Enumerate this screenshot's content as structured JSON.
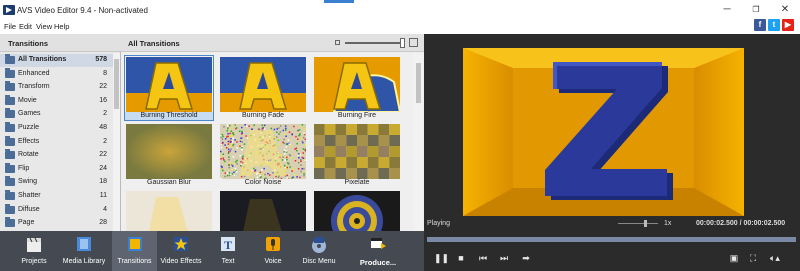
{
  "window": {
    "title": "AVS Video Editor 9.4 - Non-activated",
    "controls": [
      "─",
      "❐",
      "✕"
    ]
  },
  "menu": [
    "File",
    "Edit",
    "View",
    "Help"
  ],
  "social": [
    {
      "name": "facebook-icon",
      "glyph": "f",
      "color": "#3b5998"
    },
    {
      "name": "twitter-icon",
      "glyph": "t",
      "color": "#1da1f2"
    },
    {
      "name": "youtube-icon",
      "glyph": "▶",
      "color": "#e62117"
    }
  ],
  "left_panel": {
    "header": "Transitions",
    "categories": [
      {
        "name": "All Transitions",
        "count": "578",
        "selected": true
      },
      {
        "name": "Enhanced",
        "count": "8"
      },
      {
        "name": "Transform",
        "count": "22"
      },
      {
        "name": "Movie",
        "count": "16"
      },
      {
        "name": "Games",
        "count": "2"
      },
      {
        "name": "Puzzle",
        "count": "48"
      },
      {
        "name": "Effects",
        "count": "2"
      },
      {
        "name": "Rotate",
        "count": "22"
      },
      {
        "name": "Flip",
        "count": "24"
      },
      {
        "name": "Swing",
        "count": "18"
      },
      {
        "name": "Shatter",
        "count": "11"
      },
      {
        "name": "Diffuse",
        "count": "4"
      },
      {
        "name": "Page",
        "count": "28"
      }
    ]
  },
  "center_panel": {
    "header": "All Transitions",
    "tiles": [
      {
        "label": "Burning Threshold",
        "kind": "burn",
        "selected": true
      },
      {
        "label": "Burning Fade",
        "kind": "burn"
      },
      {
        "label": "Burning Fire",
        "kind": "fire"
      },
      {
        "label": "Gaussian Blur",
        "kind": "blur"
      },
      {
        "label": "Color Noise",
        "kind": "noise"
      },
      {
        "label": "Pixelate",
        "kind": "pixel"
      },
      {
        "label": "",
        "kind": "pale"
      },
      {
        "label": "",
        "kind": "dark"
      },
      {
        "label": "",
        "kind": "swirl"
      }
    ]
  },
  "toolbar": [
    {
      "label": "Projects",
      "icon": "clapper-icon"
    },
    {
      "label": "Media Library",
      "icon": "film-icon"
    },
    {
      "label": "Transitions",
      "icon": "transitions-icon",
      "selected": true
    },
    {
      "label": "Video Effects",
      "icon": "star-icon"
    },
    {
      "label": "Text",
      "icon": "text-icon"
    },
    {
      "label": "Voice",
      "icon": "microphone-icon"
    },
    {
      "label": "Disc Menu",
      "icon": "disc-icon"
    },
    {
      "label": "Produce...",
      "icon": "produce-icon"
    }
  ],
  "player": {
    "status": "Playing",
    "speed": "1x",
    "timecode": "00:00:02.500 / 00:00:02.500",
    "progress": 1.0,
    "preview_letter": "Z",
    "buttons": [
      "pause-icon",
      "stop-icon",
      "previous-icon",
      "next-icon",
      "next-frame-icon",
      "snapshot-icon",
      "fullscreen-icon",
      "volume-icon"
    ]
  },
  "colors": {
    "toolbar_bg": "#454a52",
    "accent": "#4b87c9",
    "preview_bg": "#2b2b2b",
    "letter_blue": "#2b3a9a",
    "letter_yellow": "#f2b500"
  }
}
